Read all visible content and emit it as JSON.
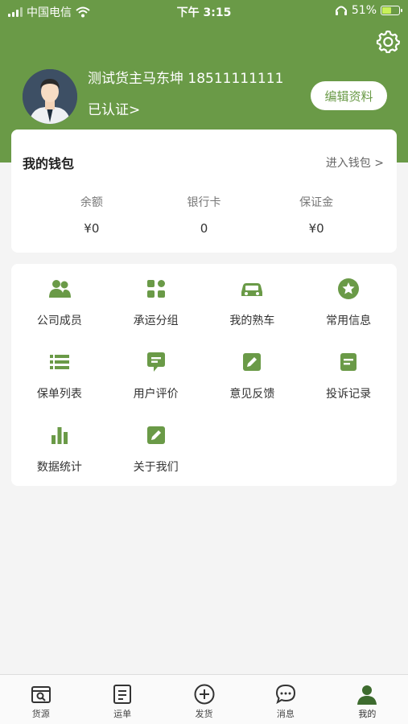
{
  "status_bar": {
    "carrier": "中国电信",
    "time": "下午 3:15",
    "battery": "51%"
  },
  "profile": {
    "name_phone": "测试货主马东坤 18511111111",
    "verify_status": "已认证>",
    "edit_label": "编辑资料"
  },
  "wallet": {
    "title": "我的钱包",
    "enter_label": "进入钱包 >",
    "items": [
      {
        "label": "余额",
        "value": "¥0"
      },
      {
        "label": "银行卡",
        "value": "0"
      },
      {
        "label": "保证金",
        "value": "¥0"
      }
    ]
  },
  "menu": {
    "items": [
      {
        "label": "公司成员",
        "icon": "people-icon"
      },
      {
        "label": "承运分组",
        "icon": "group-icon"
      },
      {
        "label": "我的熟车",
        "icon": "car-icon"
      },
      {
        "label": "常用信息",
        "icon": "star-icon"
      },
      {
        "label": "保单列表",
        "icon": "list-icon"
      },
      {
        "label": "用户评价",
        "icon": "comment-icon"
      },
      {
        "label": "意见反馈",
        "icon": "edit-icon"
      },
      {
        "label": "投诉记录",
        "icon": "document-icon"
      },
      {
        "label": "数据统计",
        "icon": "bar-chart-icon"
      },
      {
        "label": "关于我们",
        "icon": "edit-icon"
      }
    ]
  },
  "tabbar": {
    "items": [
      {
        "label": "货源",
        "icon": "cargo-search-icon"
      },
      {
        "label": "运单",
        "icon": "waybill-icon"
      },
      {
        "label": "发货",
        "icon": "plus-circle-icon"
      },
      {
        "label": "消息",
        "icon": "message-icon"
      },
      {
        "label": "我的",
        "icon": "user-icon",
        "active": true
      }
    ]
  },
  "colors": {
    "brand": "#6a9a47",
    "background": "#f4f4f4",
    "card": "#ffffff"
  }
}
